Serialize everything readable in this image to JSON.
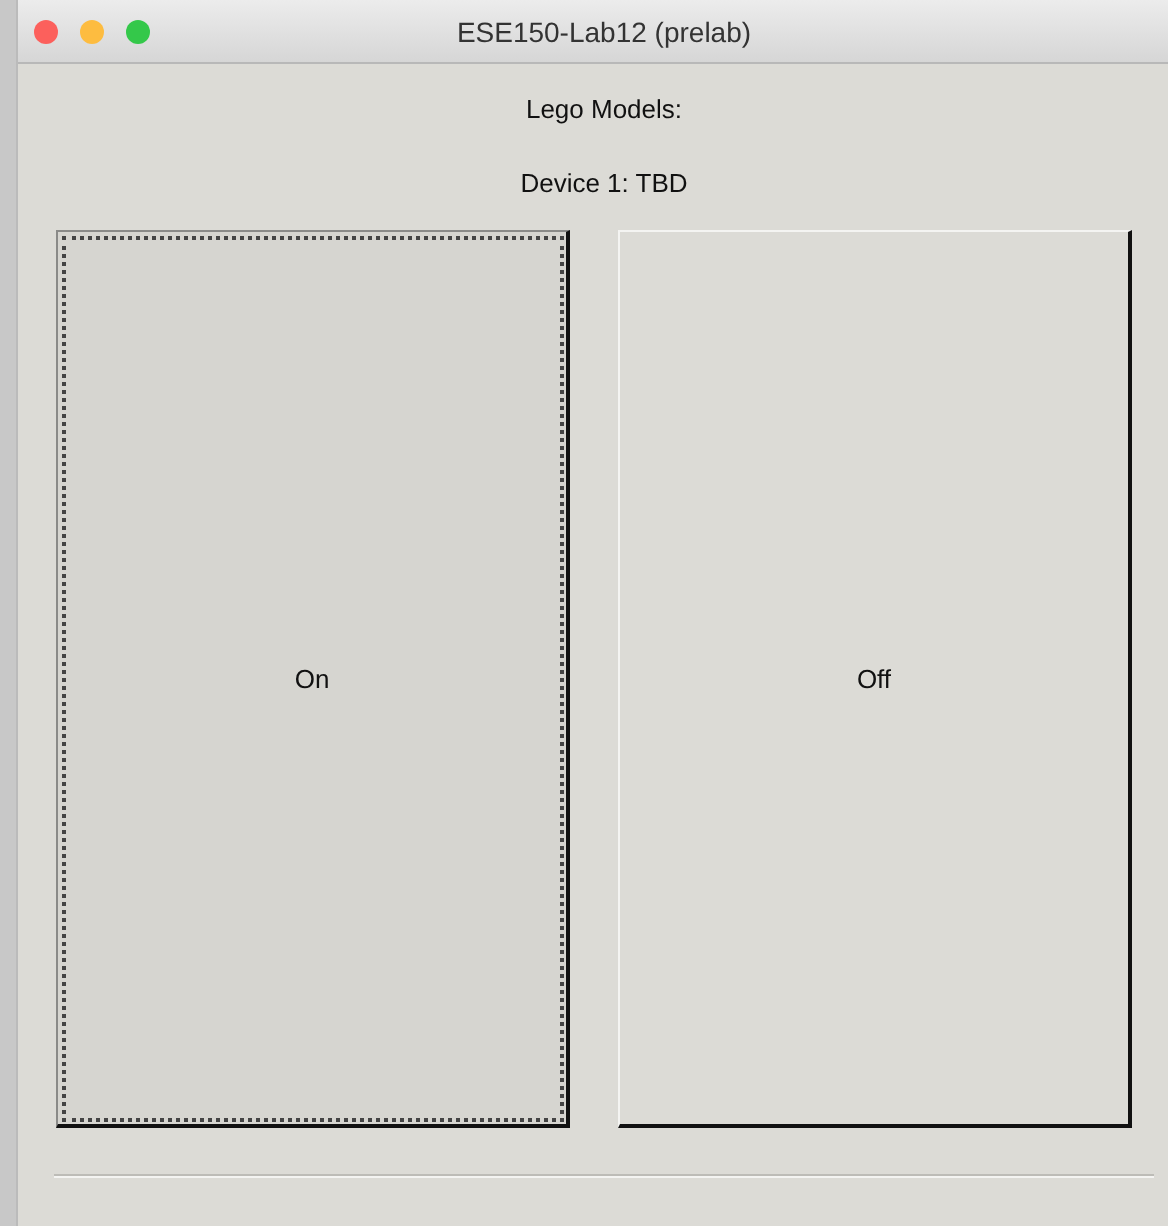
{
  "window": {
    "title": "ESE150-Lab12 (prelab)"
  },
  "labels": [
    "Lego Models:",
    "Device 1: TBD"
  ],
  "buttons": [
    {
      "label": "On",
      "focused": true
    },
    {
      "label": "Off",
      "focused": false
    }
  ]
}
